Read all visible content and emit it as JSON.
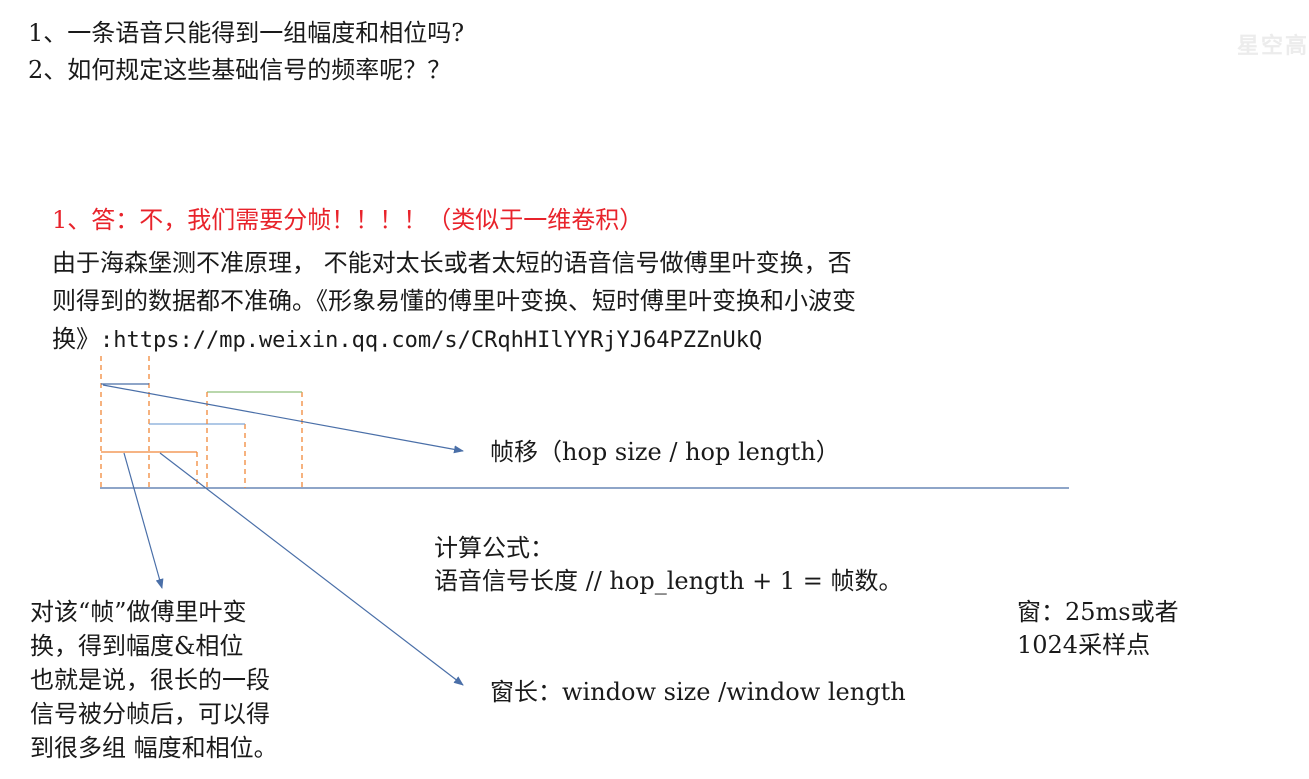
{
  "questions": [
    "1、一条语音只能得到一组幅度和相位吗?",
    "2、如何规定这些基础信号的频率呢？？"
  ],
  "watermark": "星空高",
  "answer": {
    "heading": "1、答：不，我们需要分帧！！！！（类似于一维卷积）",
    "lines": [
      "由于海森堡测不准原理， 不能对太长或者太短的语音信号做傅里叶变换，否",
      "则得到的数据都不准确。《形象易懂的傅里叶变换、短时傅里叶变换和小波变"
    ],
    "last_prefix": "换》",
    "url": ":https://mp.weixin.qq.com/s/CRqhHIlYYRjYJ64PZZnUkQ"
  },
  "diagram": {
    "hop_label": "帧移（hop size / hop length）",
    "window_label": "窗长：window size /window length",
    "colors": {
      "axis": "#4a6fa8",
      "orange": "#f0883a",
      "blue": "#7fa6d6",
      "green": "#8fbf7a",
      "arrow": "#4a6fa8"
    }
  },
  "formula": {
    "title": "计算公式：",
    "expr": "语音信号长度 // hop_length + 1  = 帧数。"
  },
  "window_note": [
    "窗：25ms或者",
    "1024采样点"
  ],
  "frame_note": [
    "对该“帧”做傅里叶变",
    "换，得到幅度&相位",
    "也就是说，很长的一段",
    "信号被分帧后，可以得",
    "到很多组 幅度和相位。"
  ]
}
